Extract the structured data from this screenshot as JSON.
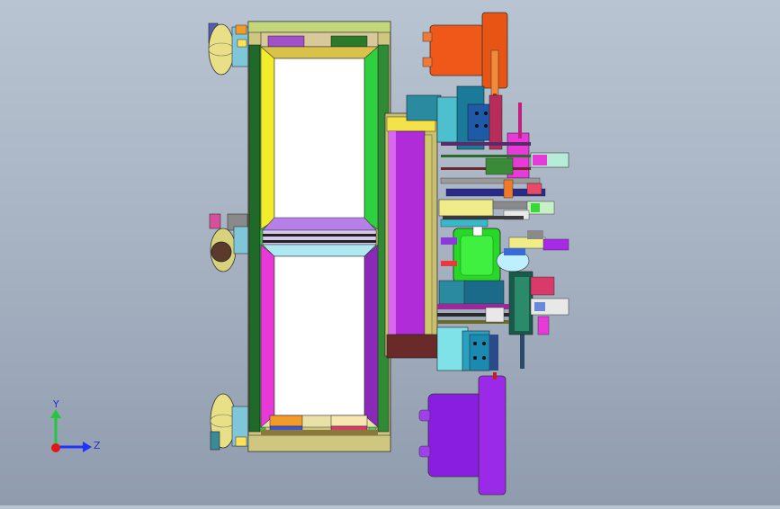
{
  "viewport": {
    "background_top": "#b9c4d2",
    "background_bottom": "#8f9cad"
  },
  "triad": {
    "y_label": "Y",
    "z_label": "Z",
    "y_color": "#22c83a",
    "z_color": "#2033ff",
    "x_color": "#e01818"
  },
  "colors": {
    "frame_tan": "#d8cf8a",
    "frame_green": "#38b238",
    "frame_yellow": "#f3ec2a",
    "frame_magenta": "#e83ad8",
    "frame_purple": "#9a2fd0",
    "orange_motor": "#f05a16",
    "violet_motor": "#9b22e8",
    "green_hub": "#28d828",
    "teal": "#3aa8b8"
  }
}
